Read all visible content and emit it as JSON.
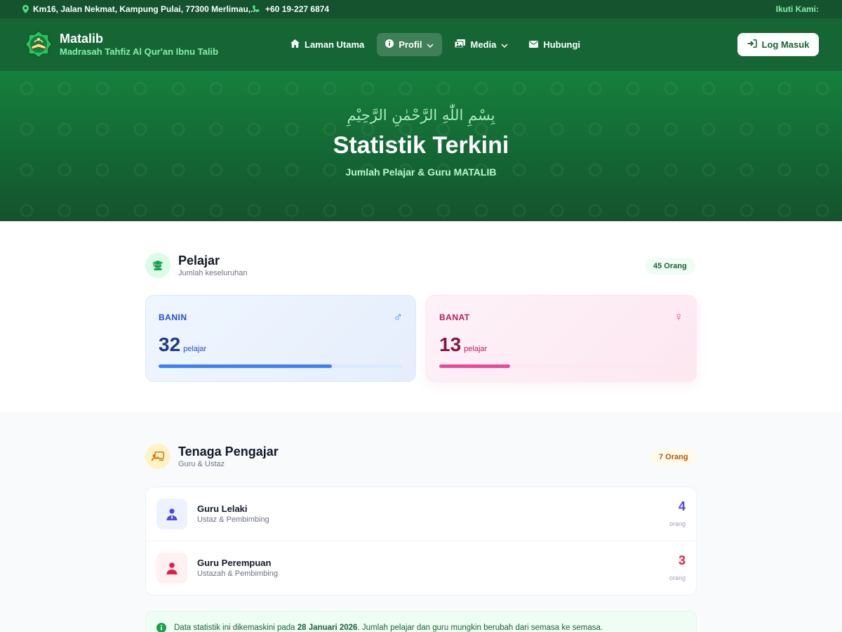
{
  "topbar": {
    "address": "Km16, Jalan Nekmat, Kampung Pulai, 77300 Merlimau,...",
    "phone": "+60 19-227 6874",
    "follow_label": "Ikuti Kami:"
  },
  "header": {
    "brand_name": "Matalib",
    "brand_subtitle": "Madrasah Tahfiz Al Qur'an Ibnu Talib",
    "nav": [
      {
        "label": "Laman Utama",
        "icon": "home-icon"
      },
      {
        "label": "Profil",
        "icon": "info-icon",
        "active": true
      },
      {
        "label": "Media",
        "icon": "gallery-icon"
      },
      {
        "label": "Hubungi",
        "icon": "envelope-icon"
      }
    ],
    "login_label": "Log Masuk"
  },
  "hero": {
    "bismillah": "بِسْمِ اللّٰهِ الرَّحْمٰنِ الرَّحِيْمِ",
    "title": "Statistik Terkini",
    "subtitle": "Jumlah Pelajar & Guru MATALIB"
  },
  "students": {
    "title": "Pelajar",
    "subtitle": "Jumlah keseluruhan",
    "total_label": "45 Orang",
    "banin": {
      "label": "BANIN",
      "value": "32",
      "unit": "pelajar",
      "progress": 0.71,
      "symbol": "♂"
    },
    "banat": {
      "label": "BANAT",
      "value": "13",
      "unit": "pelajar",
      "progress": 0.29,
      "symbol": "♀"
    }
  },
  "teachers": {
    "title": "Tenaga Pengajar",
    "subtitle": "Guru & Ustaz",
    "total_label": "7 Orang",
    "rows": [
      {
        "name": "Guru Lelaki",
        "sub": "Ustaz & Pembimbing",
        "value": "4",
        "unit": "orang"
      },
      {
        "name": "Guru Perempuan",
        "sub": "Ustazah & Pembimbing",
        "value": "3",
        "unit": "orang"
      }
    ]
  },
  "notice": {
    "prefix": "Data statistik ini dikemaskini pada ",
    "date": "28 Januari 2026",
    "suffix": ". Jumlah pelajar dan guru mungkin berubah dari semasa ke semasa."
  },
  "colors": {
    "primary_green": "#166534",
    "accent_green": "#86efac",
    "banin_blue": "#3b82f6",
    "banat_pink": "#ec4899",
    "male_teacher_indigo": "#4f46e5",
    "female_teacher_rose": "#e11d48"
  }
}
